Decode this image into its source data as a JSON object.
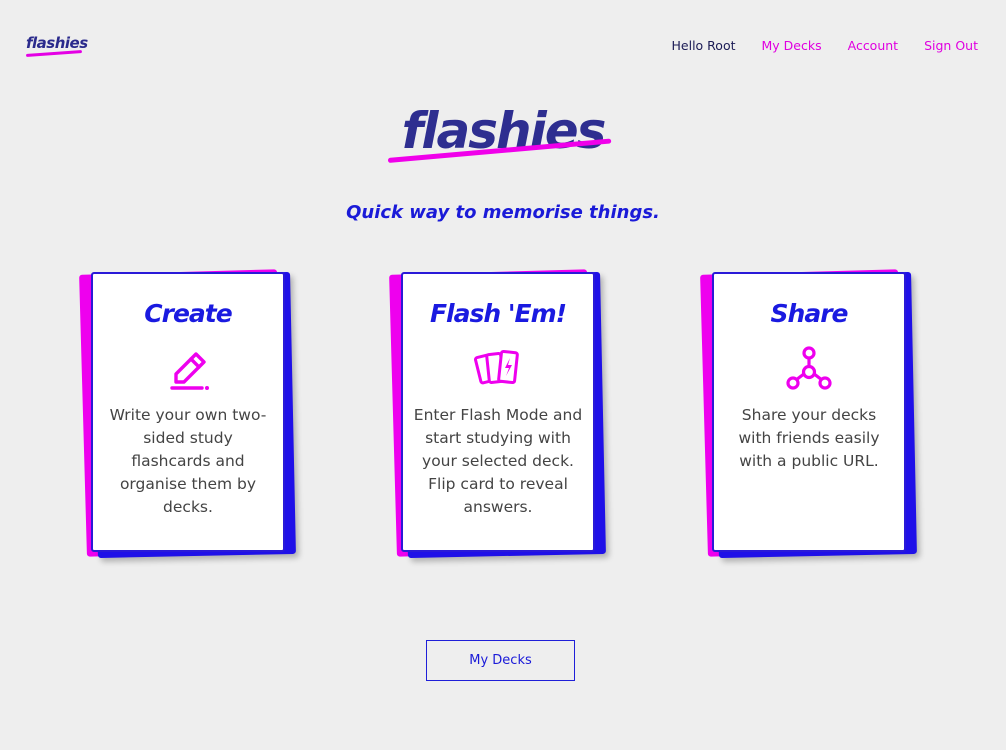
{
  "nav": {
    "logo": "flashies",
    "greeting": "Hello Root",
    "links": [
      "My Decks",
      "Account",
      "Sign Out"
    ]
  },
  "hero": {
    "logo": "flashies",
    "tagline": "Quick way to memorise things."
  },
  "cards": [
    {
      "title": "Create",
      "icon": "pencil-icon",
      "text": "Write your own two-sided study flashcards and organise them by decks."
    },
    {
      "title": "Flash 'Em!",
      "icon": "flash-cards-icon",
      "text": "Enter Flash Mode and start studying with your selected deck. Flip card to reveal answers."
    },
    {
      "title": "Share",
      "icon": "share-network-icon",
      "text": "Share your decks with friends easily with a public URL."
    }
  ],
  "cta": {
    "label": "My Decks"
  },
  "colors": {
    "accent_pink": "#e000e0",
    "accent_blue": "#1a1ad8",
    "logo_navy": "#2e2e90",
    "background": "#eeeeee"
  }
}
